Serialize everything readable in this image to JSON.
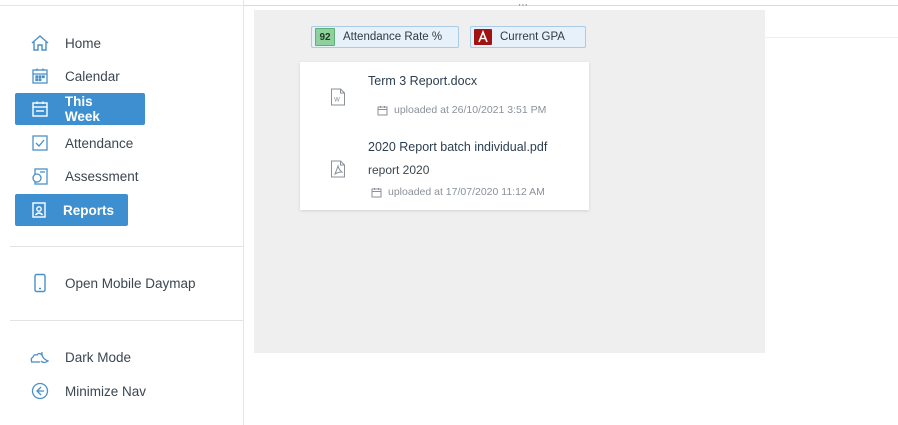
{
  "sidebar": {
    "items": [
      {
        "label": "Home",
        "icon": "home-icon",
        "active": false
      },
      {
        "label": "Calendar",
        "icon": "calendar-icon",
        "active": false
      },
      {
        "label": "This Week",
        "icon": "week-icon",
        "active": true
      },
      {
        "label": "Attendance",
        "icon": "attendance-icon",
        "active": false
      },
      {
        "label": "Assessment",
        "icon": "assessment-icon",
        "active": false
      },
      {
        "label": "Reports",
        "icon": "reports-icon",
        "active": true
      }
    ],
    "mobile": {
      "label": "Open Mobile Daymap",
      "icon": "mobile-icon"
    },
    "dark_mode": {
      "label": "Dark Mode",
      "icon": "cloud-moon-icon"
    },
    "minimize": {
      "label": "Minimize Nav",
      "icon": "arrow-left-circle-icon"
    }
  },
  "chips": [
    {
      "badge": "92",
      "label": "Attendance Rate %",
      "badge_color": "#8fd19e"
    },
    {
      "badge": "A",
      "label": "Current GPA",
      "badge_color": "#a11313"
    }
  ],
  "files": [
    {
      "title": "Term 3 Report.docx",
      "subtitle": "",
      "meta": "uploaded at 26/10/2021 3:51 PM",
      "icon": "word-file-icon"
    },
    {
      "title": "2020 Report batch individual.pdf",
      "subtitle": "report 2020",
      "meta": "uploaded at 17/07/2020 11:12 AM",
      "icon": "pdf-file-icon"
    }
  ],
  "colors": {
    "accent": "#3d8fcf",
    "panel_bg": "#efefef",
    "chip_bg": "#e7f1fa"
  }
}
